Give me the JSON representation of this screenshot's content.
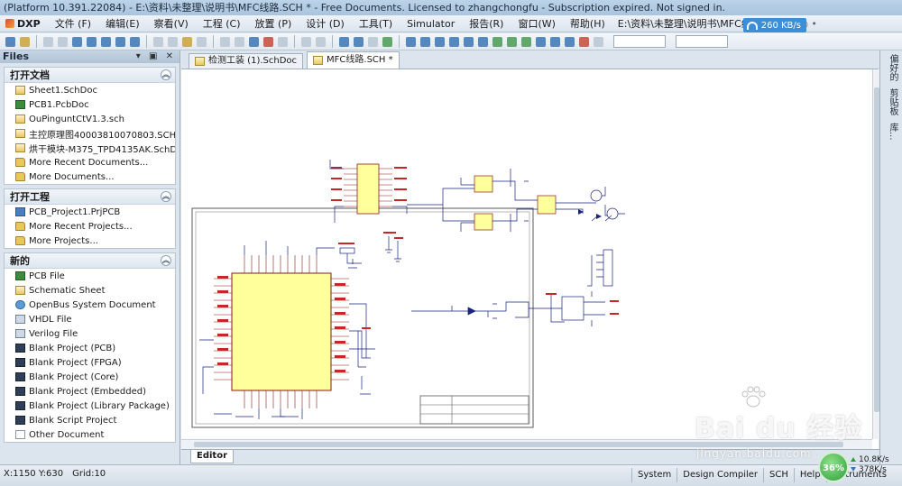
{
  "window": {
    "title": "(Platform 10.391.22084) - E:\\资料\\未整理\\说明书\\MFC线路.SCH * - Free Documents. Licensed to zhangchongfu - Subscription expired. Not signed in."
  },
  "menubar": {
    "app_label": "DXP",
    "items": [
      "文件 (F)",
      "编辑(E)",
      "察看(V)",
      "工程 (C)",
      "放置 (P)",
      "设计 (D)",
      "工具(T)",
      "Simulator",
      "报告(R)",
      "窗口(W)",
      "帮助(H)"
    ],
    "path": "E:\\资料\\未整理\\说明书\\MFC线路.",
    "nav_glyphs": "• ◉ • ◉ •"
  },
  "netspeed": {
    "value": "260 KB/s"
  },
  "files_panel": {
    "title": "Files",
    "controls": "▾ ▣ ✕",
    "sections": [
      {
        "title": "打开文档",
        "items": [
          {
            "label": "Sheet1.SchDoc",
            "icon": "sch-icon"
          },
          {
            "label": "PCB1.PcbDoc",
            "icon": "pcb-icon"
          },
          {
            "label": "OuPinguntCtV1.3.sch",
            "icon": "sch-icon"
          },
          {
            "label": "主控原理图40003810070803.SCHDOC",
            "icon": "sch-icon"
          },
          {
            "label": "烘干模块-M375_TPD4135AK.SchDoc",
            "icon": "sch-icon"
          },
          {
            "label": "More Recent Documents...",
            "icon": "folder-icon"
          },
          {
            "label": "More Documents...",
            "icon": "folder-icon"
          }
        ]
      },
      {
        "title": "打开工程",
        "items": [
          {
            "label": "PCB_Project1.PrjPCB",
            "icon": "project-icon"
          },
          {
            "label": "More Recent Projects...",
            "icon": "folder-icon"
          },
          {
            "label": "More Projects...",
            "icon": "folder-icon"
          }
        ]
      },
      {
        "title": "新的",
        "items": [
          {
            "label": "PCB File",
            "icon": "pcb-icon"
          },
          {
            "label": "Schematic Sheet",
            "icon": "sch-icon"
          },
          {
            "label": "OpenBus System Document",
            "icon": "circle-icon"
          },
          {
            "label": "VHDL File",
            "icon": "vhdl-icon"
          },
          {
            "label": "Verilog File",
            "icon": "vhdl-icon"
          },
          {
            "label": "Blank Project (PCB)",
            "icon": "chip-icon"
          },
          {
            "label": "Blank Project (FPGA)",
            "icon": "chip-icon"
          },
          {
            "label": "Blank Project (Core)",
            "icon": "chip-icon"
          },
          {
            "label": "Blank Project (Embedded)",
            "icon": "chip-icon"
          },
          {
            "label": "Blank Project (Library Package)",
            "icon": "chip-icon"
          },
          {
            "label": "Blank Script Project",
            "icon": "chip-icon"
          },
          {
            "label": "Other Document",
            "icon": "blank-icon"
          }
        ]
      }
    ]
  },
  "doc_tabs": [
    {
      "label": "检测工装 (1).SchDoc",
      "active": false
    },
    {
      "label": "MFC线路.SCH *",
      "active": true
    }
  ],
  "side_dock": {
    "labels": [
      "偏好的",
      "剪贴板",
      "库..."
    ]
  },
  "editor_tab": {
    "label": "Editor"
  },
  "statusbar": {
    "coords": "X:1150 Y:630",
    "grid": "Grid:10",
    "buttons": [
      "System",
      "Design Compiler",
      "SCH",
      "Help",
      "Instruments"
    ]
  },
  "net_monitor": {
    "percent": "36%",
    "up": "10.8K/s",
    "down": "378K/s"
  },
  "watermark": {
    "main": "Bai du 经验",
    "sub": "jingyan.baidu.com"
  },
  "colors": {
    "accent": "#3b8fd8",
    "schematic_wire": "#1a237e",
    "component_fill": "#ffff9c",
    "component_border": "#8b1a1a",
    "pin_label": "#c62828"
  }
}
